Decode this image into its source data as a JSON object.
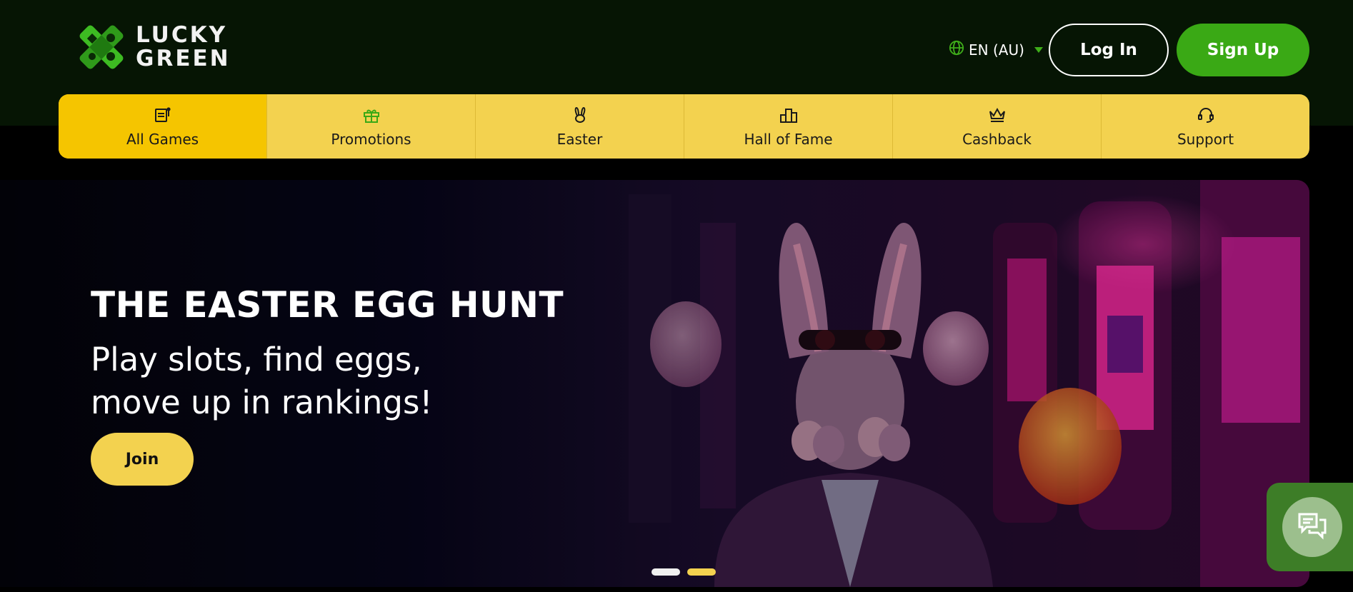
{
  "brand": {
    "line1": "LUCKY",
    "line2": "GREEN",
    "logo_icon": "clover-cross-logo-icon"
  },
  "header": {
    "language": "EN (AU)",
    "language_icon": "globe-icon",
    "login_label": "Log In",
    "signup_label": "Sign Up"
  },
  "nav": {
    "items": [
      {
        "label": "All Games",
        "icon": "slot-machine-icon",
        "active": true
      },
      {
        "label": "Promotions",
        "icon": "gift-icon",
        "active": false
      },
      {
        "label": "Easter",
        "icon": "bunny-icon",
        "active": false
      },
      {
        "label": "Hall of Fame",
        "icon": "podium-icon",
        "active": false
      },
      {
        "label": "Cashback",
        "icon": "crown-icon",
        "active": false
      },
      {
        "label": "Support",
        "icon": "headset-icon",
        "active": false
      }
    ]
  },
  "hero": {
    "title": "THE EASTER EGG HUNT",
    "subtitle_line1": "Play slots, find eggs,",
    "subtitle_line2": "move up in rankings!",
    "join_label": "Join",
    "slides_total": 2,
    "active_slide": 2
  },
  "chat": {
    "icon": "chat-bubbles-icon"
  },
  "colors": {
    "header_bg": "#061504",
    "accent_green": "#3aa915",
    "nav_yellow": "#f3d24f",
    "nav_active": "#f5c500"
  }
}
